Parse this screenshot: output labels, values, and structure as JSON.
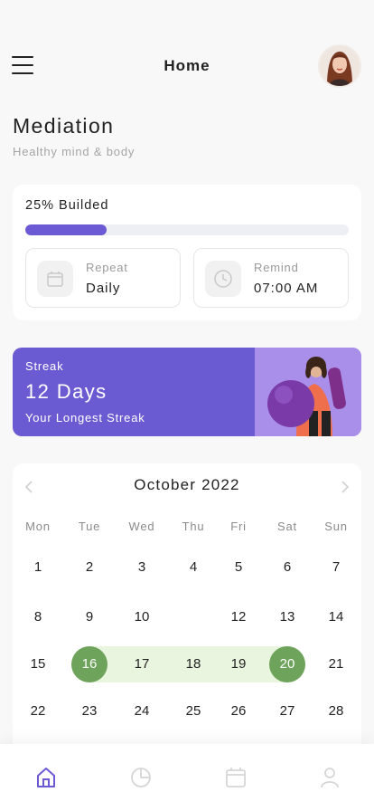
{
  "header": {
    "title": "Home",
    "avatar_icon": "user-avatar-photo"
  },
  "page": {
    "title": "Mediation",
    "subtitle": "Healthy mind & body"
  },
  "progress": {
    "label": "25% Builded",
    "value": 0.25,
    "color": "#6c5ad4",
    "repeat": {
      "label": "Repeat",
      "value": "Daily",
      "icon": "calendar-icon"
    },
    "remind": {
      "label": "Remind",
      "value": "07:00 AM",
      "icon": "clock-icon"
    }
  },
  "streak": {
    "label": "Streak",
    "value": "12 Days",
    "subtitle": "Your Longest Streak",
    "color": "#6b5bd2"
  },
  "calendar": {
    "month": "October 2022",
    "weekdays": [
      "Mon",
      "Tue",
      "Wed",
      "Thu",
      "Fri",
      "Sat",
      "Sun"
    ],
    "weeks": [
      [
        "1",
        "2",
        "3",
        "4",
        "5",
        "6",
        "7"
      ],
      [
        "8",
        "9",
        "10",
        "",
        "12",
        "13",
        "14"
      ],
      [
        "15",
        "16",
        "17",
        "18",
        "19",
        "20",
        "21"
      ],
      [
        "22",
        "23",
        "24",
        "25",
        "26",
        "27",
        "28"
      ]
    ],
    "selected_start": "16",
    "selected_end": "20",
    "range_color": "#eaf5df",
    "selected_color": "#6da35a"
  },
  "nav": {
    "items": [
      {
        "icon": "home-icon",
        "active": true
      },
      {
        "icon": "pie-chart-icon",
        "active": false
      },
      {
        "icon": "calendar-icon",
        "active": false
      },
      {
        "icon": "profile-icon",
        "active": false
      }
    ],
    "active_color": "#6c5ad4",
    "inactive_color": "#d6d6d6"
  }
}
